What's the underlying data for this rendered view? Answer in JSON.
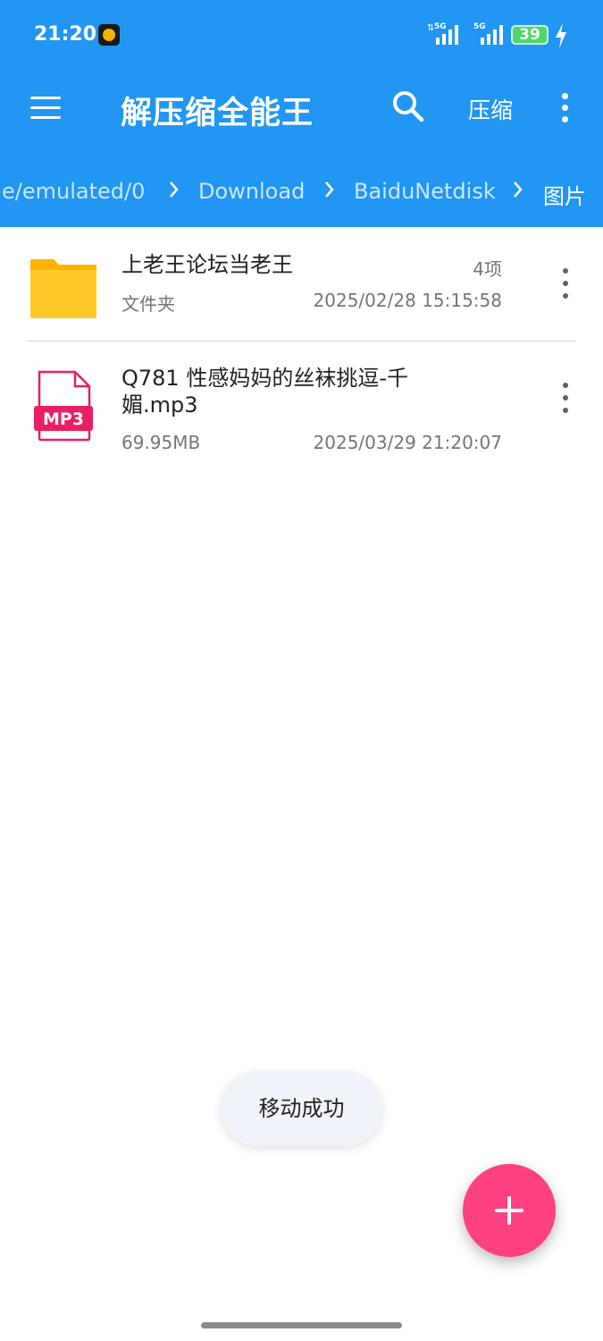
{
  "status_bar": {
    "time": "21:20",
    "signal_1_label": "5G",
    "signal_2_label": "5G",
    "battery_level": "39"
  },
  "toolbar": {
    "title": "解压缩全能王",
    "compress_label": "压缩"
  },
  "breadcrumb": [
    "e/emulated/0",
    "Download",
    "BaiduNetdisk",
    "图片"
  ],
  "files": [
    {
      "name": "上老王论坛当老王",
      "type_label": "文件夹",
      "count": "4项",
      "modified": "2025/02/28 15:15:58",
      "icon": "folder-icon"
    },
    {
      "name": "Q781 性感妈妈的丝袜挑逗-千媚.mp3",
      "size": "69.95MB",
      "modified": "2025/03/29 21:20:07",
      "icon": "mp3-file-icon",
      "icon_badge": "MP3"
    }
  ],
  "toast": "移动成功",
  "colors": {
    "header": "#2196F3",
    "fab": "#ff4081",
    "folder": "#ffca28",
    "mp3": "#e91e63"
  }
}
